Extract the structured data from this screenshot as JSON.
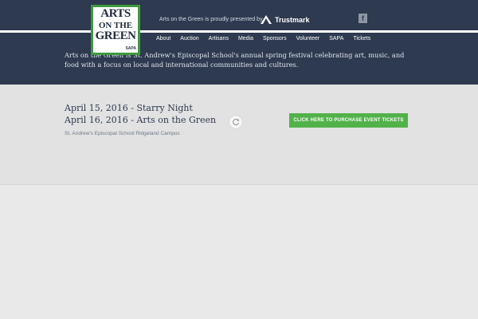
{
  "logo": {
    "line1": "ARTS",
    "line2": "ON THE",
    "line3": "GREEN",
    "badge": "SAPA"
  },
  "header": {
    "presented_text": "Arts on the Green is proudly presented by",
    "sponsor_name": "Trustmark",
    "facebook_label": "f"
  },
  "nav": {
    "items": [
      {
        "label": "About"
      },
      {
        "label": "Auction"
      },
      {
        "label": "Artisans"
      },
      {
        "label": "Media"
      },
      {
        "label": "Sponsors"
      },
      {
        "label": "Volunteer"
      },
      {
        "label": "SAPA"
      },
      {
        "label": "Tickets"
      }
    ]
  },
  "intro_text": "Arts on the Green is St. Andrew's Episcopal School's annual spring festival celebrating art, music, and food with a focus on local and international communities and cultures.",
  "event": {
    "date1": "April 15, 2016 - Starry Night",
    "date2": "April 16, 2016 - Arts on the Green",
    "location": "St. Andrew's Episcopal School Ridgeland Campus",
    "ticket_button": "CLICK HERE TO PURCHASE EVENT TICKETS"
  },
  "colors": {
    "header_bg": "#2d3a4f",
    "accent_green": "#52b24a",
    "logo_border": "#3f9a3f",
    "page_bg": "#e9e9e9"
  },
  "icons": {
    "sponsor_logo": "trustmark-logo-icon",
    "facebook": "facebook-icon",
    "loading": "refresh-spinner-icon"
  }
}
